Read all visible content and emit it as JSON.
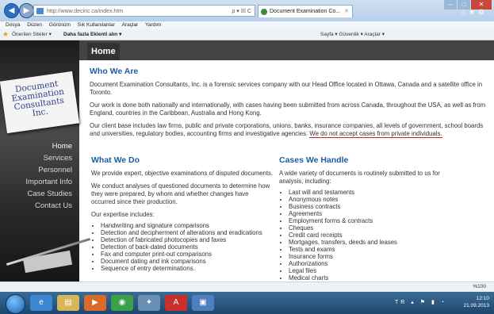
{
  "browser": {
    "url": "http://www.decinc.ca/index.htm",
    "address_tools": "ρ ▾ ☒ C",
    "tab_title": "Document Examination Co...",
    "menu": [
      "Dosya",
      "Düzen",
      "Görünüm",
      "Sık Kullanılanlar",
      "Araçlar",
      "Yardım"
    ],
    "favorites": {
      "suggested": "Önerilen Siteler ▾",
      "more_addons": "Daha fazla Eklenti alın ▾"
    },
    "command_bar": "Sayfa ▾   Güvenlik ▾   Araçlar ▾",
    "zoom": "%100"
  },
  "site": {
    "logo_lines": [
      "Document",
      "Examination",
      "Consultants",
      "Inc."
    ],
    "nav": [
      "Home",
      "Services",
      "Personnel",
      "Important Info",
      "Case Studies",
      "Contact Us"
    ],
    "page_heading": "Home"
  },
  "who": {
    "title": "Who We Are",
    "p1": "Document Examination Consultants, Inc. is a forensic services company with our Head Office located in Ottawa, Canada and a satellite office in Toronto.",
    "p2": "Our work is done both nationally and internationally, with cases having been submitted from across Canada, throughout the USA, as well as from England, countries in the Caribbean, Australia and Hong Kong.",
    "p3": "Our client base includes law firms, public and private corporations, unions, banks, insurance companies, all levels of government, school boards and universities, regulatory bodies, accounting firms and investigative agencies.",
    "p3_note": "We do not accept cases from private individuals."
  },
  "what": {
    "title": "What We Do",
    "p1": "We provide expert, objective examinations of disputed documents.",
    "p2": "We conduct analyses of questioned documents to determine how they were prepared, by whom and whether changes have occurred since their production.",
    "p3": "Our expertise includes:",
    "items": [
      "Handwriting and signature comparisons",
      "Detection and decipherment of alterations and eradications",
      "Detection of fabricated photocopies and faxes",
      "Detection of back-dated documents",
      "Fax and computer print-out comparisons",
      "Document dating and ink comparisons",
      "Sequence of entry determinations."
    ]
  },
  "cases": {
    "title": "Cases We Handle",
    "p1": "A wide variety of documents is routinely submitted to us for analysis, including:",
    "items": [
      "Last will and testaments",
      "Anonymous notes",
      "Business contracts",
      "Agreements",
      "Employment forms & contracts",
      "Cheques",
      "Credit card receipts",
      "Mortgages, transfers, deeds and leases",
      "Tests and exams",
      "Insurance forms",
      "Authorizations",
      "Legal files",
      "Medical charts"
    ]
  },
  "taskbar": {
    "time": "12:10",
    "date": "21.09.2013",
    "lang": "TR"
  }
}
